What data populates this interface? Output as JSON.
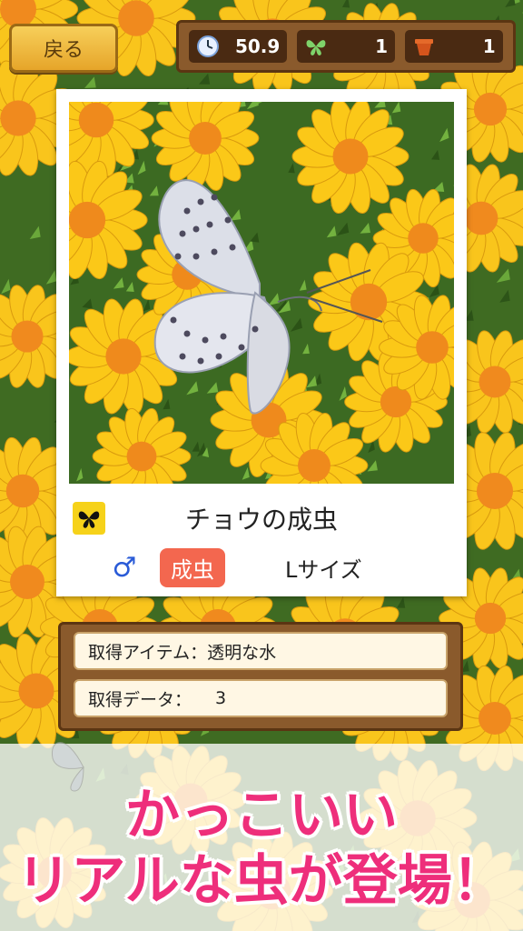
{
  "topbar": {
    "back_label": "戻る",
    "timer_value": "50.9",
    "timer_icon": "clock-icon",
    "butterfly_count": "1",
    "butterfly_icon": "butterfly-icon",
    "pot_count": "1",
    "pot_icon": "flowerpot-icon"
  },
  "card": {
    "type_icon": "butterfly-icon",
    "insect_name": "チョウの成虫",
    "sex_symbol": "♂",
    "stage_label": "成虫",
    "size_label": "Lサイズ",
    "stage_color": "#f3674f"
  },
  "info": {
    "item_label": "取得アイテム：透明な水",
    "data_label": "取得データ：",
    "data_value": "3"
  },
  "banner": {
    "line1": "かっこいい",
    "line2": "リアルな虫が登場！",
    "color": "#ee2e7b"
  }
}
